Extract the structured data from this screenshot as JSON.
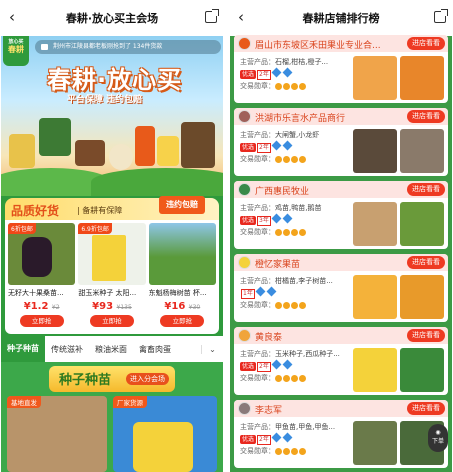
{
  "left": {
    "nav_title": "春耕·放心买主会场",
    "badge_top": "春耕",
    "badge_bottom": "放心买",
    "ticker": "荆州市江陵县都老板刚抢到了 134件货款",
    "hero_title": "春耕·放心买",
    "hero_slogan": "平台保障  违约包赔",
    "section_title": "品质好货",
    "section_sub": "| 备耕有保障",
    "section_flag": "违约包赔",
    "products": [
      {
        "tag": "6折包邮",
        "name": "无籽大十果桑苗...",
        "price": "¥1.2",
        "orig": "¥2",
        "buy": "立即抢"
      },
      {
        "tag": "6.9折包邮",
        "name": "甜玉米种子 太阳...",
        "price": "¥93",
        "orig": "¥135",
        "buy": "立即抢"
      },
      {
        "tag": "",
        "name": "东魁杨梅树苗 杯...",
        "price": "¥16",
        "orig": "¥30",
        "buy": "立即抢"
      }
    ],
    "tabs": [
      "种子种苗",
      "传统滋补",
      "粮油米面",
      "禽畜肉蛋"
    ],
    "seed_title": "种子种苗",
    "seed_enter": "进入分会场",
    "seed_cards": [
      "基地直发",
      "厂家货源"
    ]
  },
  "right": {
    "nav_title": "春耕店铺排行榜",
    "shops": [
      {
        "name": "眉山市东坡区禾田果业专业合...",
        "main_k": "主营产品：",
        "main_v": "石榴,柑桔,橙子...",
        "rank": "优选",
        "level": "2年",
        "medal_k": "交易勋章：",
        "enter": "进店看看"
      },
      {
        "name": "洪湖市乐言水产品商行",
        "main_k": "主营产品：",
        "main_v": "大闸蟹,小龙虾",
        "rank": "优选",
        "level": "2年",
        "medal_k": "交易勋章：",
        "enter": "进店看看"
      },
      {
        "name": "广西惠民牧业",
        "main_k": "主营产品：",
        "main_v": "鸡苗,鸭苗,鹅苗",
        "rank": "优选",
        "level": "3年",
        "medal_k": "交易勋章：",
        "enter": "进店看看"
      },
      {
        "name": "橙忆家果苗",
        "main_k": "主营产品：",
        "main_v": "柑橘苗,李子树苗...",
        "rank": "",
        "level": "1年",
        "medal_k": "交易勋章：",
        "enter": "进店看看"
      },
      {
        "name": "黄良泰",
        "main_k": "主营产品：",
        "main_v": "玉米种子,西瓜种子...",
        "rank": "优选",
        "level": "2年",
        "medal_k": "交易勋章：",
        "enter": "进店看看"
      },
      {
        "name": "李志军",
        "main_k": "主营产品：",
        "main_v": "甲鱼苗,甲鱼,甲鱼...",
        "rank": "优选",
        "level": "2年",
        "medal_k": "交易勋章：",
        "enter": "进店看看"
      }
    ],
    "float_btn": "下单"
  },
  "colors": {
    "brand_green": "#2f9a3c",
    "accent_red": "#ee3a22",
    "shop_name": "#d9431c"
  }
}
